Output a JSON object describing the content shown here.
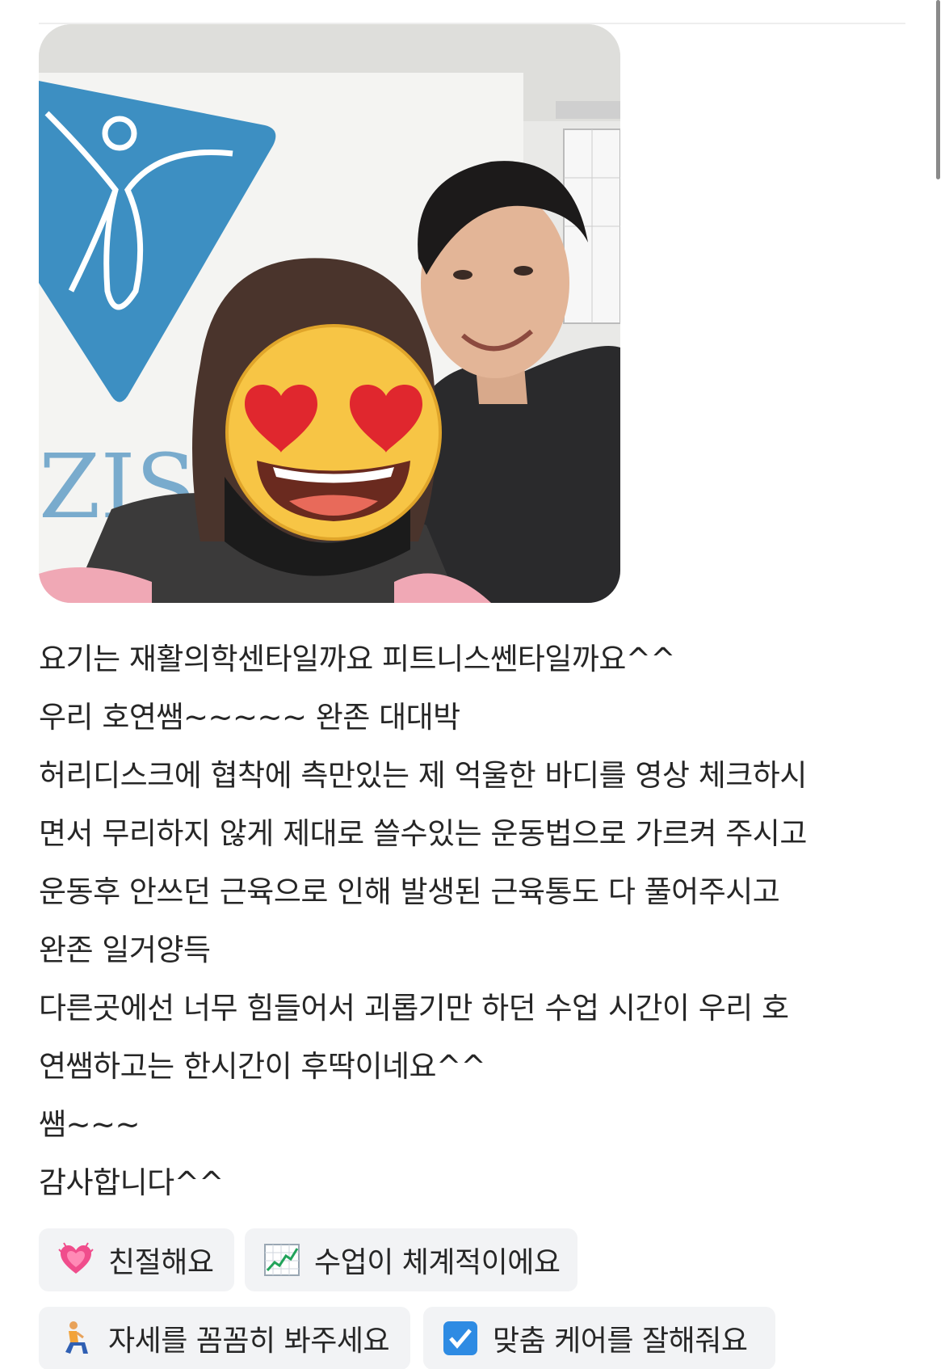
{
  "review": {
    "photo": {
      "description_icon": "selfie-photo"
    },
    "lines": [
      "요기는 재활의학센타일까요 피트니스쎈타일까요^^",
      "우리 호연쌤~~~~~ 완존 대대박",
      "허리디스크에 협착에 측만있는 제 억울한 바디를 영상 체크하시",
      "면서 무리하지 않게 제대로 쓸수있는 운동법으로 가르켜 주시고",
      "운동후 안쓰던 근육으로 인해 발생된 근육통도 다 풀어주시고",
      "완존 일거양득",
      "다른곳에선 너무 힘들어서 괴롭기만 하던 수업 시간이 우리 호",
      "연쌤하고는 한시간이 후딱이네요^^",
      "쌤~~~",
      "감사합니다^^"
    ]
  },
  "tags": [
    {
      "label": "친절해요",
      "icon": "growing-heart-icon"
    },
    {
      "label": "수업이 체계적이에요",
      "icon": "chart-increasing-icon"
    },
    {
      "label": "자세를 꼼꼼히 봐주세요",
      "icon": "kneeling-person-icon"
    },
    {
      "label": "맞춤 케어를 잘해줘요",
      "icon": "check-box-icon"
    }
  ],
  "colors": {
    "tag_background": "#f2f3f5",
    "text": "#262626",
    "logo_blue": "#3d8fc2"
  }
}
